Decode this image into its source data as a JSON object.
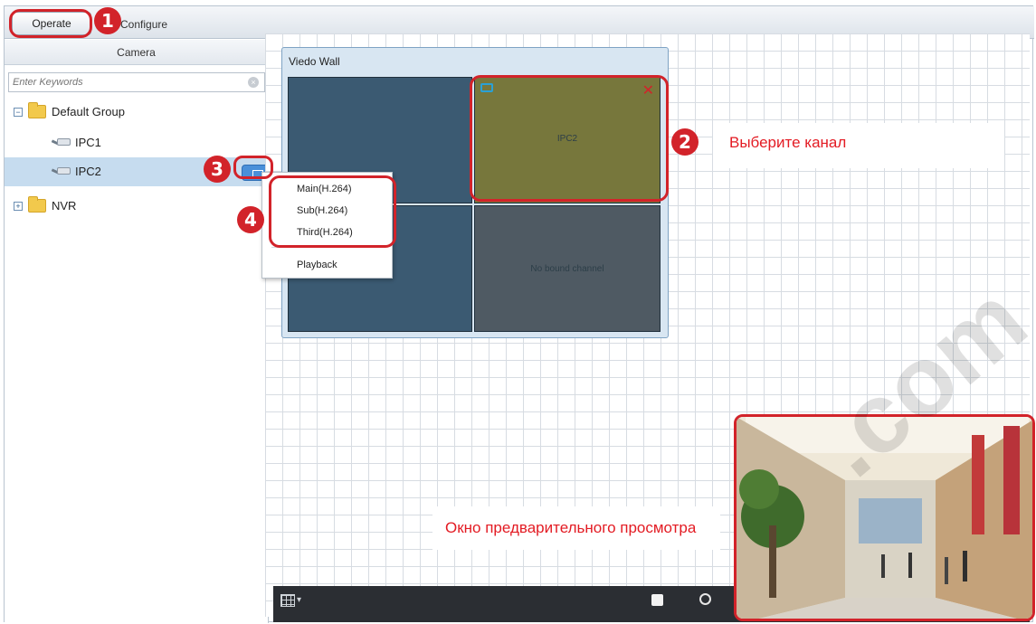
{
  "topbar": {
    "operate_label": "Operate",
    "configure_label": "Configure"
  },
  "sidebar": {
    "header": "Camera",
    "search_placeholder": "Enter Keywords",
    "tree": [
      {
        "label": "Default Group",
        "icon": "folder-icon",
        "expander": "minus"
      },
      {
        "label": "IPC1",
        "icon": "camera-icon"
      },
      {
        "label": "IPC2",
        "icon": "camera-icon",
        "selected": true
      },
      {
        "label": "NVR",
        "icon": "folder-icon",
        "expander": "plus"
      }
    ]
  },
  "context_menu": {
    "items": [
      "Main(H.264)",
      "Sub(H.264)",
      "Third(H.264)"
    ],
    "playback": "Playback"
  },
  "video_wall": {
    "title": "Viedo Wall",
    "cells": [
      {
        "label": ""
      },
      {
        "label": "IPC2"
      },
      {
        "label": ""
      },
      {
        "label": "No bound channel"
      }
    ]
  },
  "annotations": {
    "badges": [
      "1",
      "2",
      "3",
      "4"
    ],
    "select_channel": "Выберите канал",
    "preview_window": "Окно предварительного просмотра"
  },
  "colors": {
    "highlight": "#d2232a",
    "selected_row": "#c6dcef",
    "cell_active": "#77773c",
    "cell_idle": "#3b5a72",
    "cell_empty": "#4f5a63"
  }
}
